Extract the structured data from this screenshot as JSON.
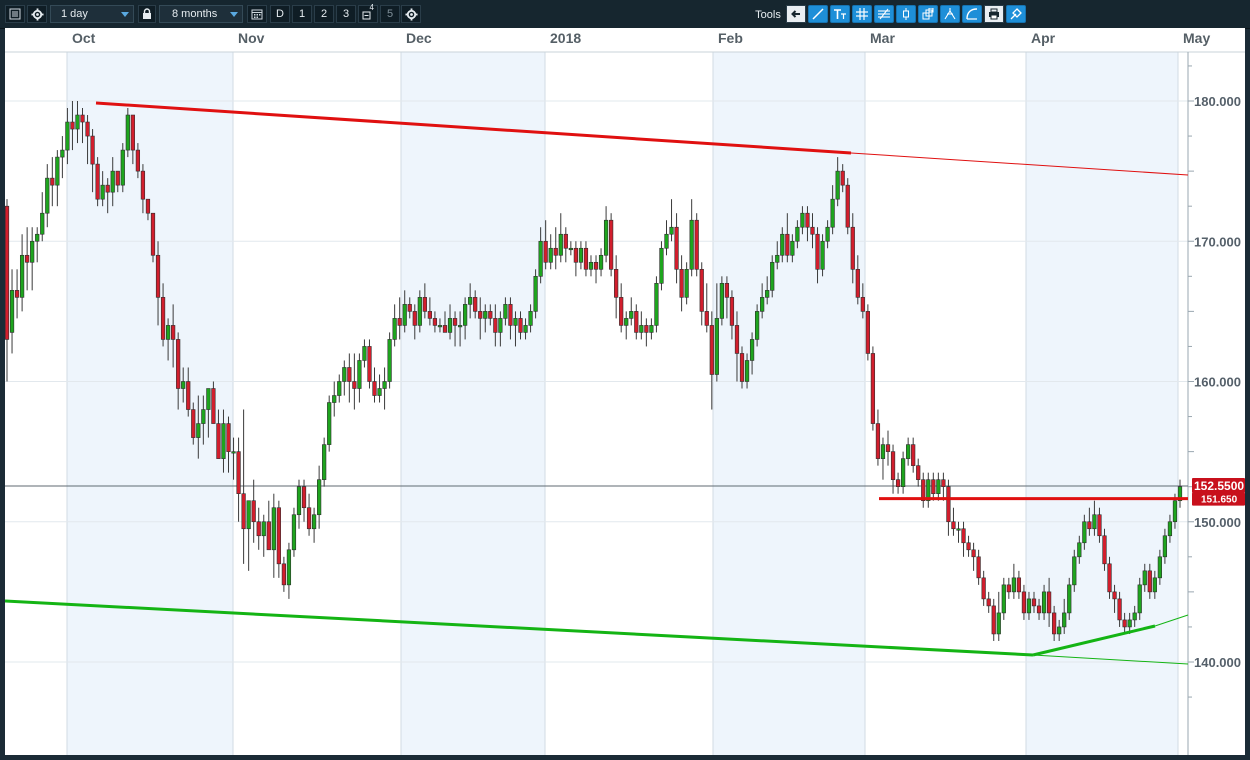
{
  "toolbar": {
    "timeframe": "1 day",
    "range": "8 months",
    "period_buttons": [
      "D",
      "1",
      "2",
      "3",
      "4",
      "5"
    ],
    "tools_label": "Tools",
    "icons": [
      "menu-icon",
      "settings-icon",
      "lock-icon",
      "calendar-icon",
      "gear-icon",
      "undo-icon",
      "trendline-icon",
      "text-tool-icon",
      "grid-icon",
      "fibonacci-icon",
      "candle-icon",
      "layers-icon",
      "fork-icon",
      "shape-icon",
      "print-icon",
      "magnet-icon"
    ]
  },
  "chart_data": {
    "type": "candlestick",
    "title": "",
    "x_axis": {
      "labels": [
        "Oct",
        "Nov",
        "Dec",
        "2018",
        "Feb",
        "Mar",
        "Apr",
        "May"
      ]
    },
    "y_axis": {
      "ticks": [
        "180.000",
        "170.000",
        "160.000",
        "150.000",
        "140.000"
      ],
      "range": [
        137.5,
        183.5
      ]
    },
    "current_price": {
      "label": "152.5500",
      "value": 152.55
    },
    "resistance_level": {
      "label": "151.650",
      "value": 151.65
    },
    "colors": {
      "up": "#1ea51e",
      "down": "#d21e2d",
      "trend_red": "#e01010",
      "trend_green": "#14b414",
      "axis_badge": "#c8101c"
    },
    "trendlines": [
      {
        "color": "red",
        "from": [
          "late Sep",
          180.0
        ],
        "to": [
          "mid Feb",
          176.0
        ],
        "extended_to": [
          "May",
          174.5
        ]
      },
      {
        "color": "red",
        "from": [
          "early Mar",
          151.65
        ],
        "to": [
          "May",
          151.65
        ]
      },
      {
        "color": "green",
        "from": [
          "late Sep",
          144.8
        ],
        "to": [
          "early Apr",
          141.0
        ],
        "extended_to": [
          "May",
          140.5
        ]
      },
      {
        "color": "green",
        "from": [
          "early Apr",
          141.0
        ],
        "to": [
          "May",
          143.3
        ]
      }
    ],
    "candles": [
      [
        172.5,
        163,
        160,
        173
      ],
      [
        163.5,
        166.5,
        162,
        168
      ],
      [
        166.5,
        166,
        164.5,
        168
      ],
      [
        166,
        169,
        165,
        170.5
      ],
      [
        169,
        168.5,
        166.5,
        171
      ],
      [
        168.5,
        170,
        166.5,
        171
      ],
      [
        170,
        170.5,
        168.5,
        171
      ],
      [
        170.5,
        172,
        170,
        173.5
      ],
      [
        172,
        174.5,
        171,
        175.5
      ],
      [
        174.5,
        174,
        172.5,
        176
      ],
      [
        174,
        176,
        172.5,
        176.5
      ],
      [
        176,
        176.5,
        174.5,
        177.5
      ],
      [
        176.5,
        178.5,
        175.5,
        179.5
      ],
      [
        178.5,
        178,
        176.5,
        180
      ],
      [
        178,
        179,
        177,
        180
      ],
      [
        179,
        178.5,
        177,
        179.5
      ],
      [
        178.5,
        177.5,
        175.5,
        179
      ],
      [
        177.5,
        175.5,
        173.5,
        178
      ],
      [
        175.5,
        173,
        172.5,
        176
      ],
      [
        173,
        174,
        172.5,
        175
      ],
      [
        174,
        173.5,
        172,
        174.5
      ],
      [
        173.5,
        175,
        172.5,
        176
      ],
      [
        175,
        174,
        173.5,
        175
      ],
      [
        174,
        176.5,
        173.5,
        177
      ],
      [
        176.5,
        179,
        176,
        179.5
      ],
      [
        179,
        176.5,
        175.5,
        179
      ],
      [
        176.5,
        175,
        174.5,
        177
      ],
      [
        175,
        173,
        172,
        175.5
      ],
      [
        173,
        172,
        171.5,
        173
      ],
      [
        172,
        169,
        168.5,
        172
      ],
      [
        169,
        166,
        164,
        170
      ],
      [
        166,
        163,
        162.5,
        167
      ],
      [
        163,
        164,
        161.5,
        164.5
      ],
      [
        164,
        163,
        161,
        165.5
      ],
      [
        163,
        159.5,
        158,
        163.5
      ],
      [
        159.5,
        160,
        158.5,
        161
      ],
      [
        160,
        158,
        157.5,
        161
      ],
      [
        158,
        156,
        155.5,
        158.5
      ],
      [
        156,
        157,
        154.5,
        159
      ],
      [
        157,
        158,
        155.5,
        159
      ],
      [
        158,
        159.5,
        156,
        159.5
      ],
      [
        159.5,
        157,
        157,
        160
      ],
      [
        157,
        154.5,
        154.5,
        158
      ],
      [
        154.5,
        157,
        153.5,
        158
      ],
      [
        157,
        155,
        153.5,
        157.5
      ],
      [
        155,
        155,
        153,
        156
      ],
      [
        155,
        152,
        150,
        156
      ],
      [
        152,
        149.5,
        147,
        158
      ],
      [
        149.5,
        151.5,
        146.5,
        151.5
      ],
      [
        151.5,
        150,
        148.5,
        153
      ],
      [
        150,
        149,
        148,
        151
      ],
      [
        149,
        150,
        147.5,
        150.5
      ],
      [
        150,
        148,
        148,
        151.5
      ],
      [
        148,
        151,
        146,
        152
      ],
      [
        151,
        147,
        146,
        151.5
      ],
      [
        147,
        145.5,
        145,
        147.5
      ],
      [
        145.5,
        148,
        144.5,
        148.5
      ],
      [
        148,
        150.5,
        147.5,
        151
      ],
      [
        150.5,
        152.5,
        149.5,
        153
      ],
      [
        152.5,
        151,
        150,
        153
      ],
      [
        151,
        149.5,
        149,
        152
      ],
      [
        149.5,
        150.5,
        148.5,
        151
      ],
      [
        150.5,
        153,
        149.5,
        154
      ],
      [
        153,
        155.5,
        152.5,
        156
      ],
      [
        155.5,
        158.5,
        155,
        159
      ],
      [
        158.5,
        159,
        157.5,
        160
      ],
      [
        159,
        160,
        158.5,
        160.5
      ],
      [
        160,
        161,
        159,
        161.5
      ],
      [
        161,
        160,
        158.5,
        162
      ],
      [
        160,
        159.5,
        158,
        162
      ],
      [
        159.5,
        161.5,
        158.5,
        162
      ],
      [
        161.5,
        162.5,
        161,
        163
      ],
      [
        162.5,
        160,
        159.5,
        163
      ],
      [
        160,
        159,
        158.5,
        161
      ],
      [
        159,
        159.5,
        158.5,
        160.5
      ],
      [
        159.5,
        160,
        158,
        161
      ],
      [
        160,
        163,
        159.5,
        163.5
      ],
      [
        163,
        164.5,
        162.5,
        165.5
      ],
      [
        164.5,
        164,
        163,
        166
      ],
      [
        164,
        165.5,
        163.5,
        166.5
      ],
      [
        165.5,
        165,
        164.5,
        166
      ],
      [
        165,
        164,
        163,
        165.5
      ],
      [
        164,
        166,
        163.5,
        166.5
      ],
      [
        166,
        165,
        164.5,
        167
      ],
      [
        165,
        164.5,
        164,
        166
      ],
      [
        164.5,
        164,
        163.5,
        165
      ],
      [
        164,
        164,
        163.5,
        164.5
      ],
      [
        164,
        163.5,
        163.5,
        165
      ],
      [
        163.5,
        164.5,
        163,
        165.5
      ],
      [
        164.5,
        164,
        162.5,
        165
      ],
      [
        164,
        164,
        162.5,
        165
      ],
      [
        164,
        165.5,
        163,
        166
      ],
      [
        165.5,
        166,
        164.5,
        167
      ],
      [
        166,
        165,
        164.5,
        166.5
      ],
      [
        165,
        164.5,
        163,
        166
      ],
      [
        164.5,
        165,
        163.5,
        165.5
      ],
      [
        165,
        164.5,
        164,
        165.5
      ],
      [
        164.5,
        163.5,
        162.5,
        165.5
      ],
      [
        163.5,
        164.5,
        162.5,
        165
      ],
      [
        164.5,
        165.5,
        164,
        166
      ],
      [
        165.5,
        164,
        163,
        166
      ],
      [
        164,
        164.5,
        162.5,
        165
      ],
      [
        164.5,
        163.5,
        163,
        165
      ],
      [
        163.5,
        164,
        163,
        164.5
      ],
      [
        164,
        165,
        163.5,
        165.5
      ],
      [
        165,
        167.5,
        164.5,
        168
      ],
      [
        167.5,
        170,
        167,
        171
      ],
      [
        170,
        168.5,
        168,
        171.5
      ],
      [
        168.5,
        169.5,
        168,
        170.5
      ],
      [
        169.5,
        169,
        168,
        171
      ],
      [
        169,
        170.5,
        168.5,
        172
      ],
      [
        170.5,
        169.5,
        168.5,
        171
      ],
      [
        169.5,
        169.5,
        169,
        170
      ],
      [
        169.5,
        168.5,
        167.5,
        170
      ],
      [
        168.5,
        169.5,
        168,
        170
      ],
      [
        169.5,
        168,
        167.5,
        170
      ],
      [
        168,
        168.5,
        167.5,
        169
      ],
      [
        168.5,
        168,
        167,
        169
      ],
      [
        168,
        169,
        167.5,
        169.5
      ],
      [
        169,
        171.5,
        168.5,
        172.5
      ],
      [
        171.5,
        168,
        167.5,
        172
      ],
      [
        168,
        166,
        164.5,
        169
      ],
      [
        166,
        164,
        163.5,
        167
      ],
      [
        164,
        164.5,
        163,
        165
      ],
      [
        164.5,
        165,
        164,
        166
      ],
      [
        165,
        163.5,
        163,
        165.5
      ],
      [
        163.5,
        164,
        163,
        165
      ],
      [
        164,
        163.5,
        162.5,
        164.5
      ],
      [
        163.5,
        164,
        163,
        164.5
      ],
      [
        164,
        167,
        163.5,
        167.5
      ],
      [
        167,
        169.5,
        166.5,
        170
      ],
      [
        169.5,
        170.5,
        169,
        171.5
      ],
      [
        170.5,
        171,
        170,
        173
      ],
      [
        171,
        168,
        167,
        172
      ],
      [
        168,
        166,
        165,
        169
      ],
      [
        166,
        168,
        165.5,
        168.5
      ],
      [
        168,
        171.5,
        167.5,
        173
      ],
      [
        171.5,
        168,
        167.5,
        172
      ],
      [
        168,
        165,
        164,
        168.5
      ],
      [
        165,
        164,
        163.5,
        167
      ],
      [
        164,
        160.5,
        158,
        165
      ],
      [
        160.5,
        164.5,
        160,
        167
      ],
      [
        164.5,
        167,
        164,
        167.5
      ],
      [
        167,
        166,
        164.5,
        167.5
      ],
      [
        166,
        164,
        163,
        166.5
      ],
      [
        164,
        162,
        160,
        165
      ],
      [
        162,
        160,
        159.5,
        162.5
      ],
      [
        160,
        161.5,
        159.5,
        162
      ],
      [
        161.5,
        163,
        160.5,
        163.5
      ],
      [
        163,
        165,
        162.5,
        165.5
      ],
      [
        165,
        166,
        164.5,
        167
      ],
      [
        166,
        166.5,
        165.5,
        167.5
      ],
      [
        166.5,
        168.5,
        166,
        169
      ],
      [
        168.5,
        169,
        168,
        170
      ],
      [
        169,
        170.5,
        168.5,
        171
      ],
      [
        170.5,
        169,
        168.5,
        172
      ],
      [
        169,
        170,
        168.5,
        170.5
      ],
      [
        170,
        171,
        169.5,
        171.5
      ],
      [
        171,
        172,
        170.5,
        172.5
      ],
      [
        172,
        171,
        170,
        172.5
      ],
      [
        171,
        170.5,
        169.5,
        172
      ],
      [
        170.5,
        168,
        167,
        171
      ],
      [
        168,
        170,
        167.5,
        170.5
      ],
      [
        170,
        171,
        169.5,
        171.5
      ],
      [
        171,
        173,
        170.5,
        174
      ],
      [
        173,
        175,
        172.5,
        176
      ],
      [
        175,
        174,
        173.5,
        175.5
      ],
      [
        174,
        171,
        170.5,
        174.5
      ],
      [
        171,
        168,
        167,
        172
      ],
      [
        168,
        166,
        165.5,
        169
      ],
      [
        166,
        165,
        164.5,
        167
      ],
      [
        165,
        162,
        161.5,
        165.5
      ],
      [
        162,
        157,
        156.5,
        162.5
      ],
      [
        157,
        154.5,
        154,
        158
      ],
      [
        154.5,
        155.5,
        153,
        156
      ],
      [
        155.5,
        155,
        154,
        156.5
      ],
      [
        155,
        153,
        152,
        155.5
      ],
      [
        153,
        152.5,
        152,
        153.5
      ],
      [
        152.5,
        154.5,
        152,
        155
      ],
      [
        154.5,
        155.5,
        154,
        156
      ],
      [
        155.5,
        154,
        153.5,
        156
      ],
      [
        154,
        153,
        152.5,
        154.5
      ],
      [
        153,
        151.5,
        151,
        153.5
      ],
      [
        151.5,
        153,
        151,
        153.5
      ],
      [
        153,
        152,
        151.5,
        153.5
      ],
      [
        152,
        153,
        151.5,
        153.5
      ],
      [
        153,
        152.5,
        151.5,
        153.5
      ],
      [
        152.5,
        150,
        149,
        153
      ],
      [
        150,
        149.5,
        149,
        151
      ],
      [
        149.5,
        149.5,
        148.5,
        150
      ],
      [
        149.5,
        148.5,
        147.5,
        150
      ],
      [
        148.5,
        148,
        147.5,
        149
      ],
      [
        148,
        147.5,
        146.5,
        148.5
      ],
      [
        147.5,
        146,
        145.5,
        148
      ],
      [
        146,
        144.5,
        144,
        146.5
      ],
      [
        144.5,
        144,
        143.5,
        145
      ],
      [
        144,
        142,
        141.5,
        144.5
      ],
      [
        142,
        143.5,
        141.5,
        145
      ],
      [
        143.5,
        145.5,
        143,
        146
      ],
      [
        145.5,
        145,
        144.5,
        146
      ],
      [
        145,
        146,
        144.5,
        147
      ],
      [
        146,
        145,
        144.5,
        146.5
      ],
      [
        145,
        143.5,
        143,
        145.5
      ],
      [
        143.5,
        144.5,
        143,
        145
      ],
      [
        144.5,
        144,
        143.5,
        145
      ],
      [
        144,
        143.5,
        143,
        144.5
      ],
      [
        143.5,
        145,
        143,
        145.5
      ],
      [
        145,
        143.5,
        142.5,
        146
      ],
      [
        143.5,
        142,
        141.5,
        144
      ],
      [
        142,
        142.5,
        141.5,
        143
      ],
      [
        142.5,
        143.5,
        142,
        144.5
      ],
      [
        143.5,
        145.5,
        143,
        146
      ],
      [
        145.5,
        147.5,
        145,
        148
      ],
      [
        147.5,
        148.5,
        147,
        149
      ],
      [
        148.5,
        150,
        148,
        150.5
      ],
      [
        150,
        149.5,
        149,
        151
      ],
      [
        149.5,
        150.5,
        149,
        151.5
      ],
      [
        150.5,
        149,
        148.5,
        151
      ],
      [
        149,
        147,
        146.5,
        149.5
      ],
      [
        147,
        145,
        144.5,
        147.5
      ],
      [
        145,
        144.5,
        143.5,
        145.5
      ],
      [
        144.5,
        143,
        142.5,
        145
      ],
      [
        143,
        142.5,
        142,
        143.5
      ],
      [
        142.5,
        143,
        142,
        143.5
      ],
      [
        143,
        143.5,
        142.5,
        144
      ],
      [
        143.5,
        145.5,
        143,
        146
      ],
      [
        145.5,
        146.5,
        145,
        147
      ],
      [
        146.5,
        145,
        144.5,
        147
      ],
      [
        145,
        146,
        144.5,
        146.5
      ],
      [
        146,
        147.5,
        145.5,
        148
      ],
      [
        147.5,
        149,
        147,
        149.5
      ],
      [
        149,
        150,
        148.5,
        150.5
      ],
      [
        150,
        151.5,
        149.5,
        152
      ],
      [
        151.5,
        152.5,
        151,
        153
      ]
    ]
  }
}
